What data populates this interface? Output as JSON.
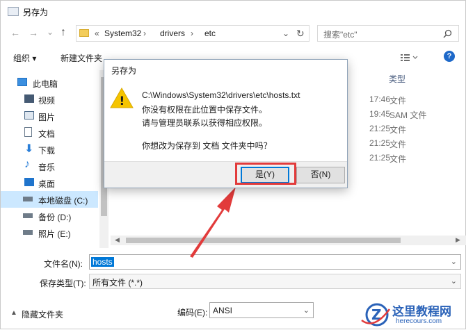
{
  "window": {
    "title": "另存为"
  },
  "nav": {
    "back": "←",
    "forward": "→",
    "dropdown": "⌄",
    "up": "↑",
    "breadcrumb_overflow": "«",
    "breadcrumb": [
      "System32",
      "drivers",
      "etc"
    ],
    "separator": "›",
    "refresh": "↻",
    "search_placeholder": "搜索\"etc\""
  },
  "toolbar": {
    "organize": "组织 ▾",
    "new_folder": "新建文件夹"
  },
  "sidebar": {
    "items": [
      {
        "label": "此电脑",
        "icon": "computer-icon",
        "color": "#3b8fe0"
      },
      {
        "label": "视频",
        "icon": "video-icon",
        "color": "#455a73"
      },
      {
        "label": "图片",
        "icon": "pictures-icon",
        "color": "#4d6b8a"
      },
      {
        "label": "文档",
        "icon": "documents-icon",
        "color": "#6a7b8d"
      },
      {
        "label": "下载",
        "icon": "downloads-icon",
        "color": "#2b7fd8"
      },
      {
        "label": "音乐",
        "icon": "music-icon",
        "color": "#2b7fd8"
      },
      {
        "label": "桌面",
        "icon": "desktop-icon",
        "color": "#1f74cc"
      },
      {
        "label": "本地磁盘 (C:)",
        "icon": "drive-icon",
        "color": "#6f7c89",
        "selected": true
      },
      {
        "label": "备份 (D:)",
        "icon": "drive-icon",
        "color": "#6f7c89"
      },
      {
        "label": "照片 (E:)",
        "icon": "drive-icon",
        "color": "#6f7c89"
      }
    ]
  },
  "file_list": {
    "type_header": "类型",
    "rows": [
      {
        "time": "17:46",
        "type": "文件"
      },
      {
        "time": "19:45",
        "type": "SAM 文件"
      },
      {
        "time": "21:25",
        "type": "文件"
      },
      {
        "time": "21:25",
        "type": "文件"
      },
      {
        "time": "21:25",
        "type": "文件"
      }
    ]
  },
  "bottom": {
    "filename_label": "文件名(N):",
    "filename_value": "hosts",
    "filetype_label": "保存类型(T):",
    "filetype_value": "所有文件  (*.*)",
    "hide_folders": "隐藏文件夹",
    "encoding_label": "编码(E):",
    "encoding_value": "ANSI"
  },
  "dialog": {
    "title": "另存为",
    "lines": [
      "C:\\Windows\\System32\\drivers\\etc\\hosts.txt",
      "你没有权限在此位置中保存文件。",
      "请与管理员联系以获得相应权限。",
      "你想改为保存到 文档 文件夹中吗？"
    ],
    "yes": "是(Y)",
    "no": "否(N)",
    "warning_glyph": "!"
  },
  "watermark": {
    "title": "这里教程网",
    "url": "herecours.com"
  },
  "colors": {
    "accent": "#0078d7",
    "annotation": "#e23b3b",
    "selected": "#cce8ff",
    "warning": "#f5c400"
  }
}
